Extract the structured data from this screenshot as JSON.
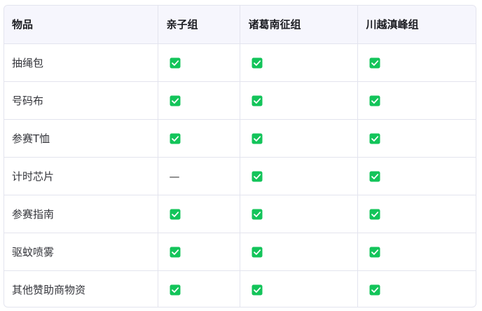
{
  "table": {
    "headers": [
      "物品",
      "亲子组",
      "诸葛南征组",
      "川越滇峰组"
    ],
    "check_color": "#13c45a",
    "rows": [
      {
        "item": "抽绳包",
        "cells": [
          "check",
          "check",
          "check"
        ]
      },
      {
        "item": "号码布",
        "cells": [
          "check",
          "check",
          "check"
        ]
      },
      {
        "item": "参赛T恤",
        "cells": [
          "check",
          "check",
          "check"
        ]
      },
      {
        "item": "计时芯片",
        "cells": [
          "—",
          "check",
          "check"
        ]
      },
      {
        "item": "参赛指南",
        "cells": [
          "check",
          "check",
          "check"
        ]
      },
      {
        "item": "驱蚊喷雾",
        "cells": [
          "check",
          "check",
          "check"
        ]
      },
      {
        "item": "其他赞助商物资",
        "cells": [
          "check",
          "check",
          "check"
        ]
      }
    ]
  }
}
